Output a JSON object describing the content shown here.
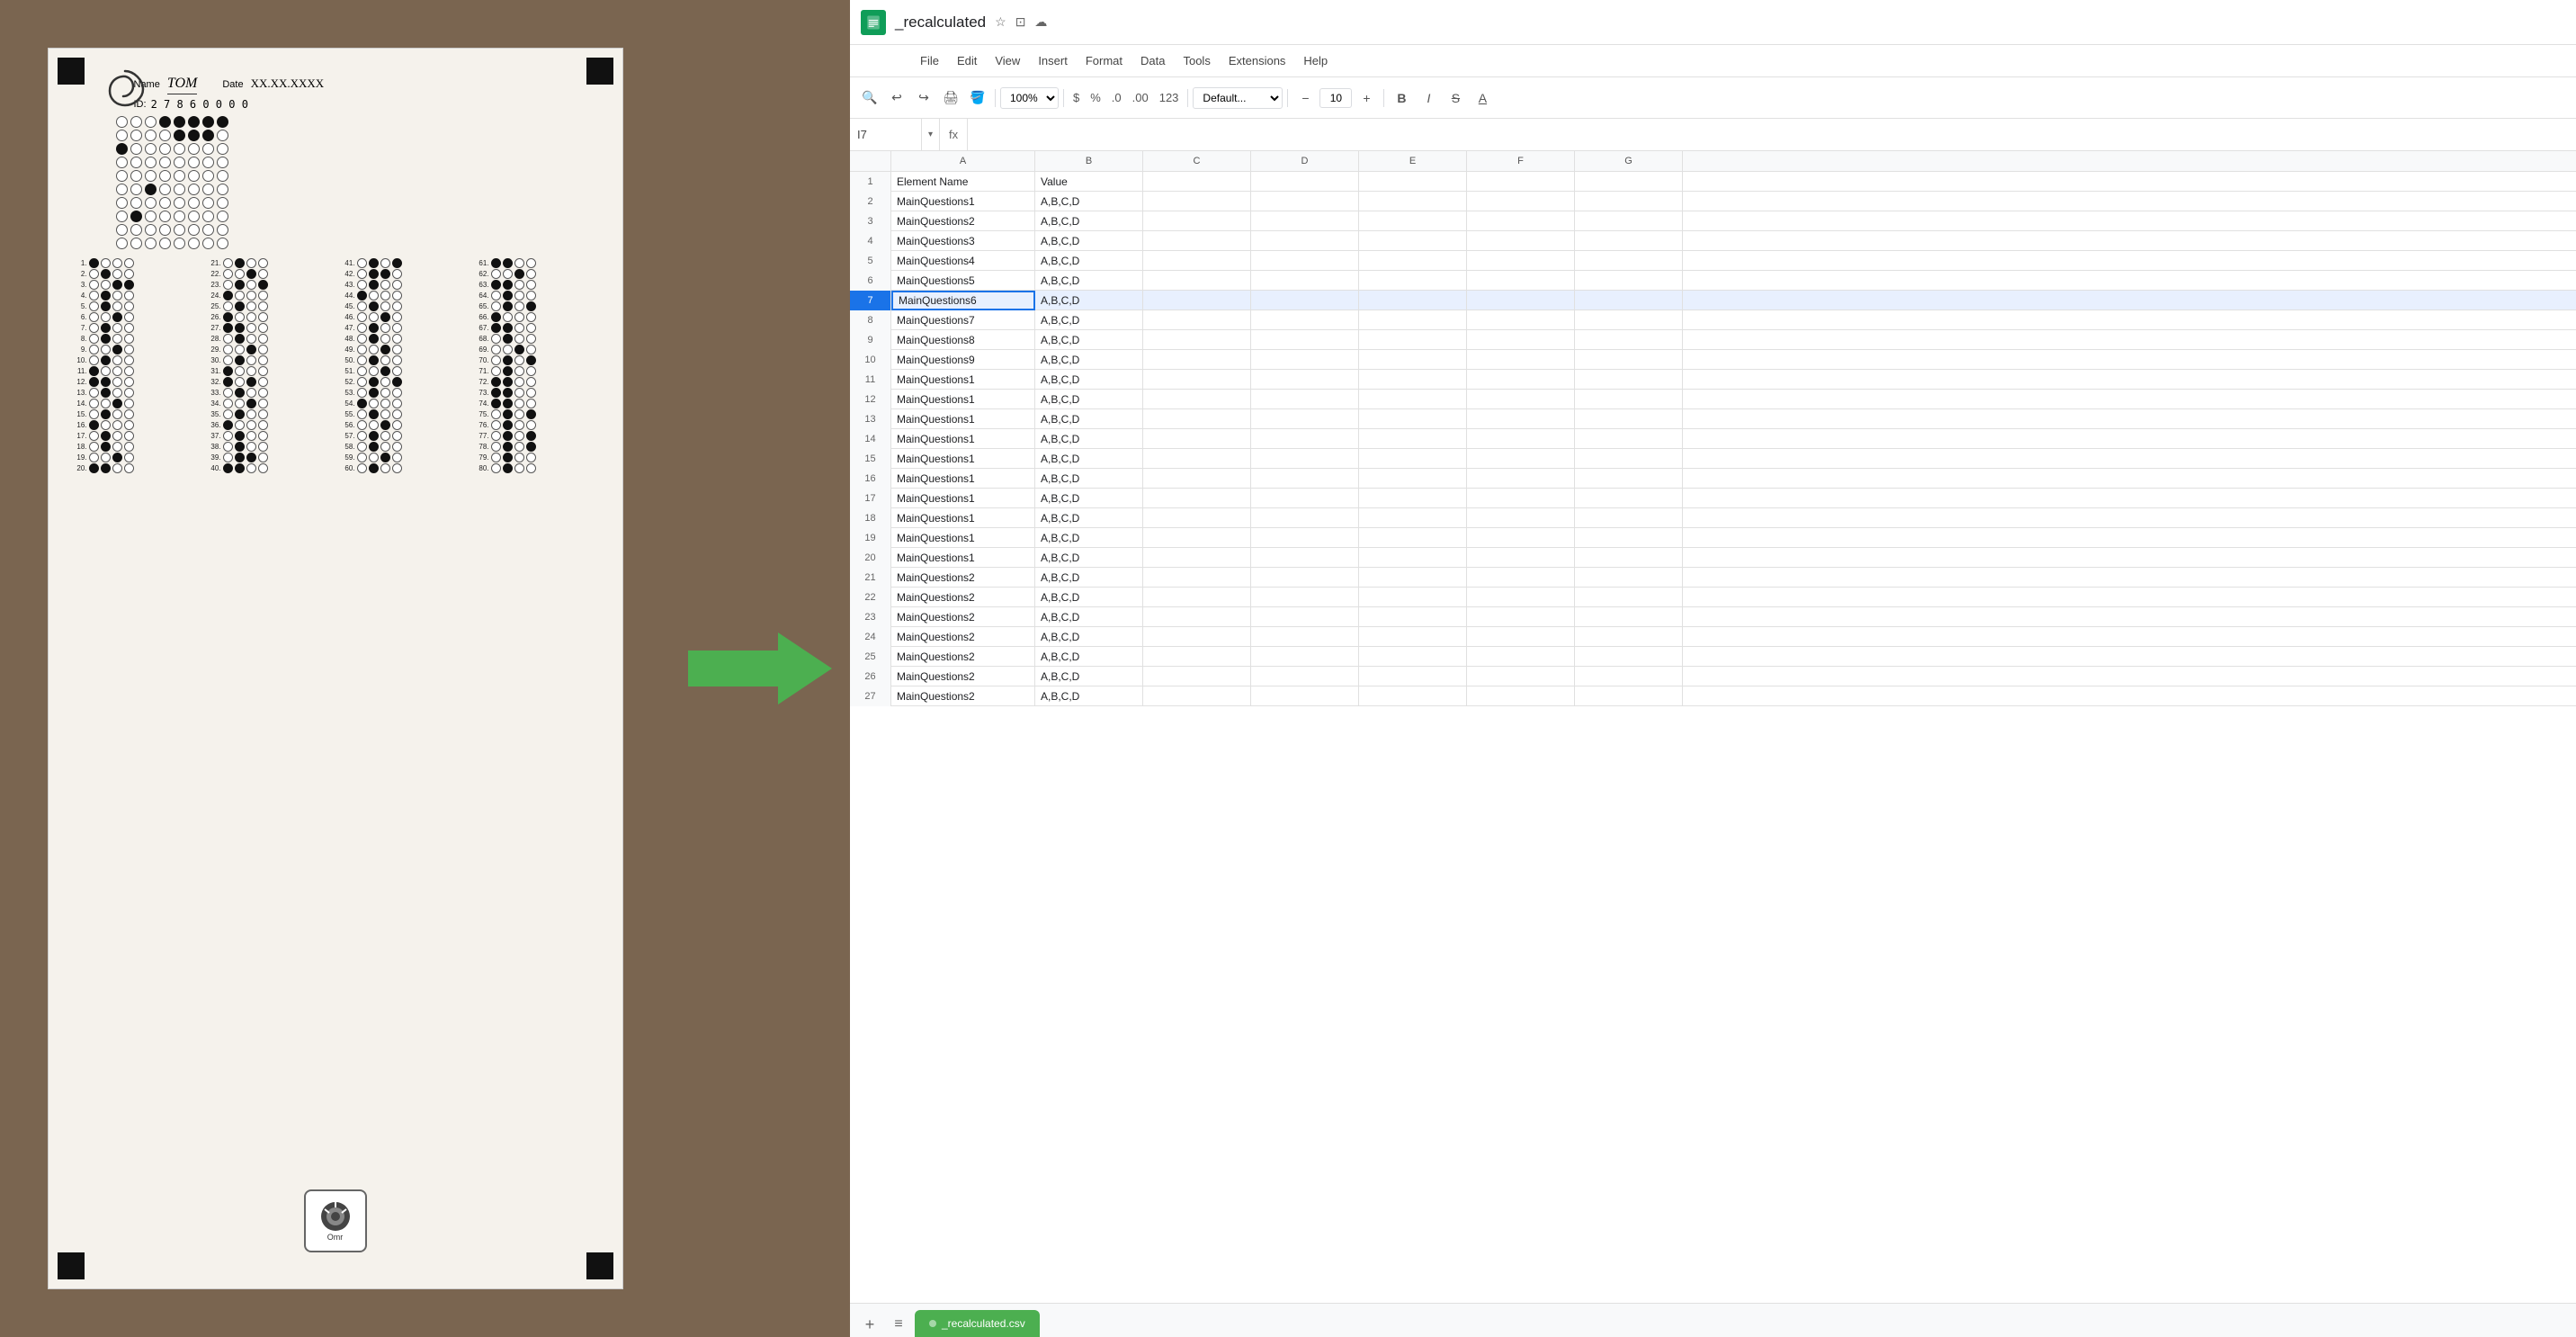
{
  "left": {
    "omr_label": "Omr",
    "name_label": "Name",
    "name_value": "TOM",
    "date_label": "Date",
    "date_value": "XX.XX.XXXX",
    "id_label": "ID:",
    "id_value": "2 7 8 6 0 0 0 0"
  },
  "spreadsheet": {
    "title": "_recalculated",
    "file_name": "_recalculated.csv",
    "cell_ref": "I7",
    "zoom": "100%",
    "font": "Default...",
    "font_size": "10",
    "menu_items": [
      "File",
      "Edit",
      "View",
      "Insert",
      "Format",
      "Data",
      "Tools",
      "Extensions",
      "Help"
    ],
    "columns": [
      "A",
      "B",
      "C",
      "D",
      "E",
      "F",
      "G"
    ],
    "header_row": {
      "col_a": "Element Name",
      "col_b": "Value"
    },
    "rows": [
      {
        "num": 1,
        "col_a": "Element Name",
        "col_b": "Value",
        "selected": false
      },
      {
        "num": 2,
        "col_a": "MainQuestions1",
        "col_b": "A,B,C,D",
        "selected": false
      },
      {
        "num": 3,
        "col_a": "MainQuestions2",
        "col_b": "A,B,C,D",
        "selected": false
      },
      {
        "num": 4,
        "col_a": "MainQuestions3",
        "col_b": "A,B,C,D",
        "selected": false
      },
      {
        "num": 5,
        "col_a": "MainQuestions4",
        "col_b": "A,B,C,D",
        "selected": false
      },
      {
        "num": 6,
        "col_a": "MainQuestions5",
        "col_b": "A,B,C,D",
        "selected": false
      },
      {
        "num": 7,
        "col_a": "MainQuestions6",
        "col_b": "A,B,C,D",
        "selected": true
      },
      {
        "num": 8,
        "col_a": "MainQuestions7",
        "col_b": "A,B,C,D",
        "selected": false
      },
      {
        "num": 9,
        "col_a": "MainQuestions8",
        "col_b": "A,B,C,D",
        "selected": false
      },
      {
        "num": 10,
        "col_a": "MainQuestions9",
        "col_b": "A,B,C,D",
        "selected": false
      },
      {
        "num": 11,
        "col_a": "MainQuestions1",
        "col_b": "A,B,C,D",
        "selected": false
      },
      {
        "num": 12,
        "col_a": "MainQuestions1",
        "col_b": "A,B,C,D",
        "selected": false
      },
      {
        "num": 13,
        "col_a": "MainQuestions1",
        "col_b": "A,B,C,D",
        "selected": false
      },
      {
        "num": 14,
        "col_a": "MainQuestions1",
        "col_b": "A,B,C,D",
        "selected": false
      },
      {
        "num": 15,
        "col_a": "MainQuestions1",
        "col_b": "A,B,C,D",
        "selected": false
      },
      {
        "num": 16,
        "col_a": "MainQuestions1",
        "col_b": "A,B,C,D",
        "selected": false
      },
      {
        "num": 17,
        "col_a": "MainQuestions1",
        "col_b": "A,B,C,D",
        "selected": false
      },
      {
        "num": 18,
        "col_a": "MainQuestions1",
        "col_b": "A,B,C,D",
        "selected": false
      },
      {
        "num": 19,
        "col_a": "MainQuestions1",
        "col_b": "A,B,C,D",
        "selected": false
      },
      {
        "num": 20,
        "col_a": "MainQuestions1",
        "col_b": "A,B,C,D",
        "selected": false
      },
      {
        "num": 21,
        "col_a": "MainQuestions2",
        "col_b": "A,B,C,D",
        "selected": false
      },
      {
        "num": 22,
        "col_a": "MainQuestions2",
        "col_b": "A,B,C,D",
        "selected": false
      },
      {
        "num": 23,
        "col_a": "MainQuestions2",
        "col_b": "A,B,C,D",
        "selected": false
      },
      {
        "num": 24,
        "col_a": "MainQuestions2",
        "col_b": "A,B,C,D",
        "selected": false
      },
      {
        "num": 25,
        "col_a": "MainQuestions2",
        "col_b": "A,B,C,D",
        "selected": false
      },
      {
        "num": 26,
        "col_a": "MainQuestions2",
        "col_b": "A,B,C,D",
        "selected": false
      },
      {
        "num": 27,
        "col_a": "MainQuestions2",
        "col_b": "A,B,C,D",
        "selected": false
      }
    ]
  },
  "arrow": {
    "color": "#4CAF50"
  }
}
